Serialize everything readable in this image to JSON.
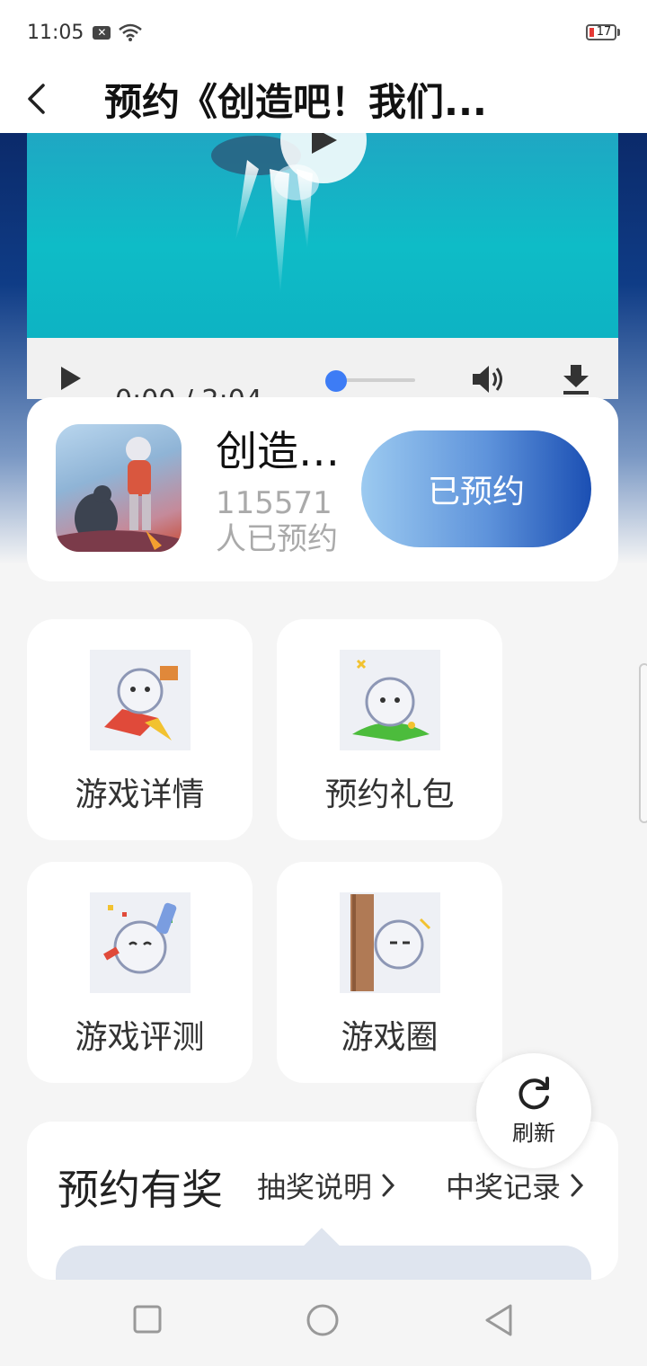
{
  "status_bar": {
    "time": "11:05",
    "battery_level": "17",
    "battery_color": "#e53935"
  },
  "header": {
    "title": "预约《创造吧！我们..."
  },
  "video": {
    "time_display": "0:00 / 2:04",
    "progress": 0,
    "accent": "#3d7cf5"
  },
  "game": {
    "name": "创造…",
    "reserve_count": "115571",
    "reserve_suffix": "人已预约",
    "reserve_button": "已预约"
  },
  "features": [
    {
      "label": "游戏详情",
      "icon": "mascot-rocket-icon"
    },
    {
      "label": "预约礼包",
      "icon": "mascot-gift-icon"
    },
    {
      "label": "游戏评测",
      "icon": "mascot-celebrate-icon"
    },
    {
      "label": "游戏圈",
      "icon": "mascot-peek-icon"
    }
  ],
  "refresh": {
    "label": "刷新"
  },
  "reward": {
    "title": "预约有奖",
    "rules_link": "抽奖说明",
    "records_link": "中奖记录"
  }
}
